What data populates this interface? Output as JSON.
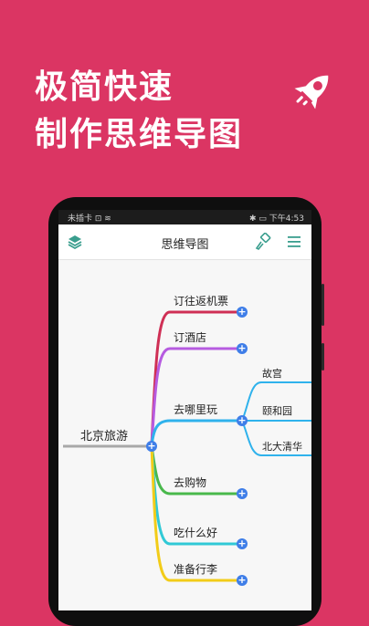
{
  "headline": {
    "line1": "极简快速",
    "line2": "制作思维导图"
  },
  "status_bar": {
    "left": "未插卡 ⊡ ≋",
    "right": "✱ ▭ 下午4:53"
  },
  "app_bar": {
    "title": "思维导图",
    "left_icon": "layers-icon",
    "right_icons": [
      "paint-brush-icon",
      "menu-icon"
    ]
  },
  "colors": {
    "background": "#db3563",
    "accent_blue": "#3f7ee8",
    "branch_red": "#cf2f55",
    "branch_purple": "#b65be0",
    "branch_blue": "#2fb2ec",
    "branch_green": "#49b84b",
    "branch_cyan": "#31c9d6",
    "branch_yellow": "#f2cc19",
    "root_line": "#a8a8a8"
  },
  "mindmap": {
    "root": "北京旅游",
    "branches": [
      {
        "label": "订往返机票"
      },
      {
        "label": "订酒店"
      },
      {
        "label": "去哪里玩",
        "children": [
          "故宫",
          "颐和园",
          "北大清华"
        ]
      },
      {
        "label": "去购物"
      },
      {
        "label": "吃什么好"
      },
      {
        "label": "准备行李"
      }
    ]
  }
}
